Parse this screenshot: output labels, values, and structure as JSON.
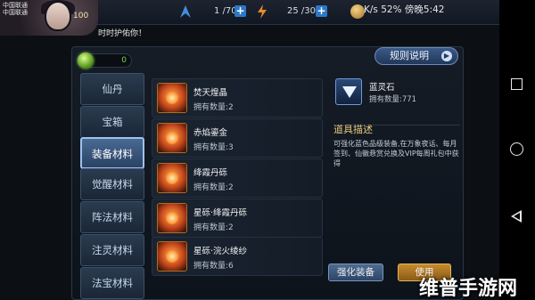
{
  "hud": {
    "server_line1": "中国联通",
    "server_line2": "中国联通",
    "level": "100",
    "stamina": "1 /70",
    "energy": "25 /30",
    "notice": "时时护佑你！"
  },
  "status_bar": {
    "text": "K/s  52%  傍晚5:42"
  },
  "currency": {
    "value": "0"
  },
  "rules_button": {
    "label": "规则说明",
    "arrow": "▶"
  },
  "categories": [
    {
      "label": "仙丹",
      "active": false
    },
    {
      "label": "宝箱",
      "active": false
    },
    {
      "label": "装备材料",
      "active": true
    },
    {
      "label": "觉醒材料",
      "active": false
    },
    {
      "label": "阵法材料",
      "active": false
    },
    {
      "label": "注灵材料",
      "active": false
    },
    {
      "label": "法宝材料",
      "active": false
    }
  ],
  "items": [
    {
      "name": "焚天煌晶",
      "qty": "拥有数量:2"
    },
    {
      "name": "赤焰鎏金",
      "qty": "拥有数量:3"
    },
    {
      "name": "绛霞丹砾",
      "qty": "拥有数量:2"
    },
    {
      "name": "星砾·绛霞丹砾",
      "qty": "拥有数量:2"
    },
    {
      "name": "星砾·浣火绫纱",
      "qty": "拥有数量:6"
    }
  ],
  "detail": {
    "name": "蓝灵石",
    "qty": "拥有数量:771",
    "desc_title": "道具描述",
    "desc_text": "可强化蓝色品级装备,在万象夜话、每月签到、仙徽悬赏兑换及VIP每周礼包中获得"
  },
  "actions": {
    "enhance": "强化装备",
    "use": "使用"
  },
  "watermark": "维普手游网",
  "icons": [
    "avatar",
    "stamina-icon",
    "energy-icon",
    "coin-icon",
    "gem-icon",
    "item-icon",
    "blue-stone-icon",
    "nav-square-icon",
    "nav-circle-icon",
    "nav-back-icon"
  ]
}
